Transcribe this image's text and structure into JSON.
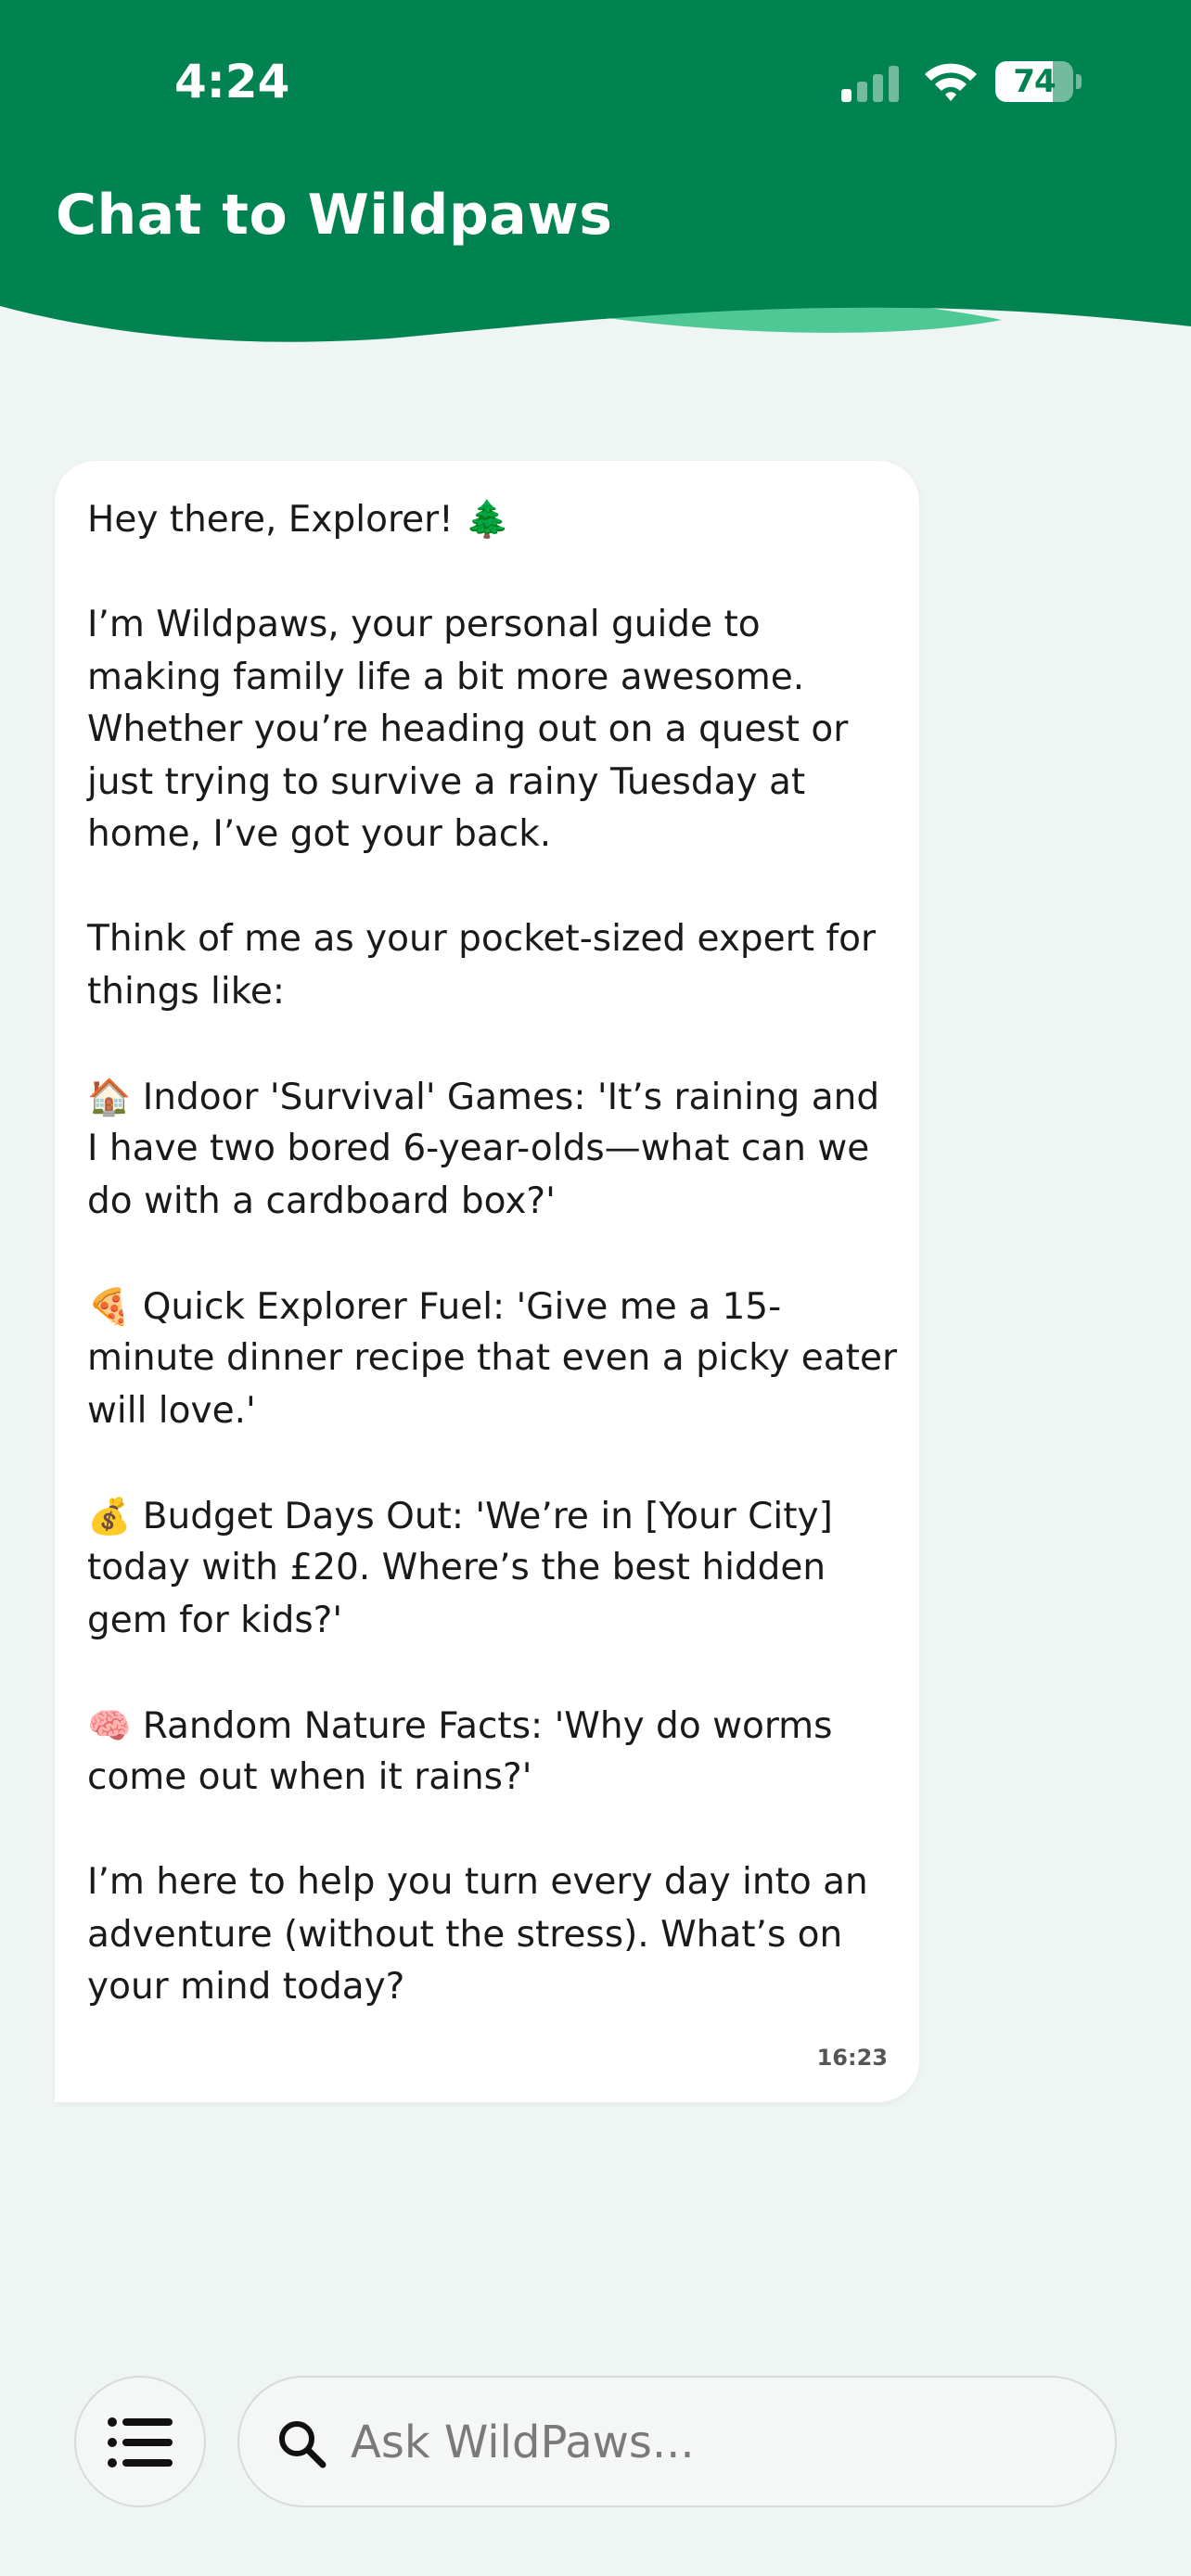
{
  "status_bar": {
    "time": "4:24",
    "battery_level": "74",
    "battery_fraction": 0.74
  },
  "header": {
    "title": "Chat to Wildpaws"
  },
  "colors": {
    "header_green": "#008351",
    "wave_highlight": "#4ec995",
    "background": "#eff5f3",
    "bubble": "#ffffff"
  },
  "message": {
    "greeting": "Hey there, Explorer! 🌲",
    "intro": [
      "I’m Wildpaws, your personal guide to",
      "making family life a bit more awesome.",
      "Whether you’re heading out on a quest or",
      "just trying to survive a rainy Tuesday at",
      "home, I’ve got your back."
    ],
    "think": [
      "Think of me as your pocket-sized expert for",
      "things like:"
    ],
    "items": [
      {
        "emoji": "🏠",
        "lines": [
          " Indoor 'Survival' Games: 'It’s raining and",
          "I have two bored 6-year-olds—what can we",
          "do with a cardboard box?'"
        ]
      },
      {
        "emoji": "🍕",
        "lines": [
          " Quick Explorer Fuel: 'Give me a 15-",
          "minute dinner recipe that even a picky eater",
          "will love.'"
        ]
      },
      {
        "emoji": "💰",
        "lines": [
          " Budget Days Out: 'We’re in [Your City]",
          "today with £20. Where’s the best hidden",
          "gem for kids?'"
        ]
      },
      {
        "emoji": "🧠",
        "lines": [
          " Random Nature Facts: 'Why do worms",
          "come out when it rains?'"
        ]
      }
    ],
    "outro": [
      "I’m here to help you turn every day into an",
      "adventure (without the stress). What’s on",
      "your mind today?"
    ],
    "time": "16:23"
  },
  "input": {
    "placeholder": "Ask WildPaws..."
  },
  "icons": {
    "menu": "list-menu-icon",
    "search": "search-icon",
    "cellular": "cellular-signal-icon",
    "wifi": "wifi-icon",
    "battery": "battery-icon"
  }
}
